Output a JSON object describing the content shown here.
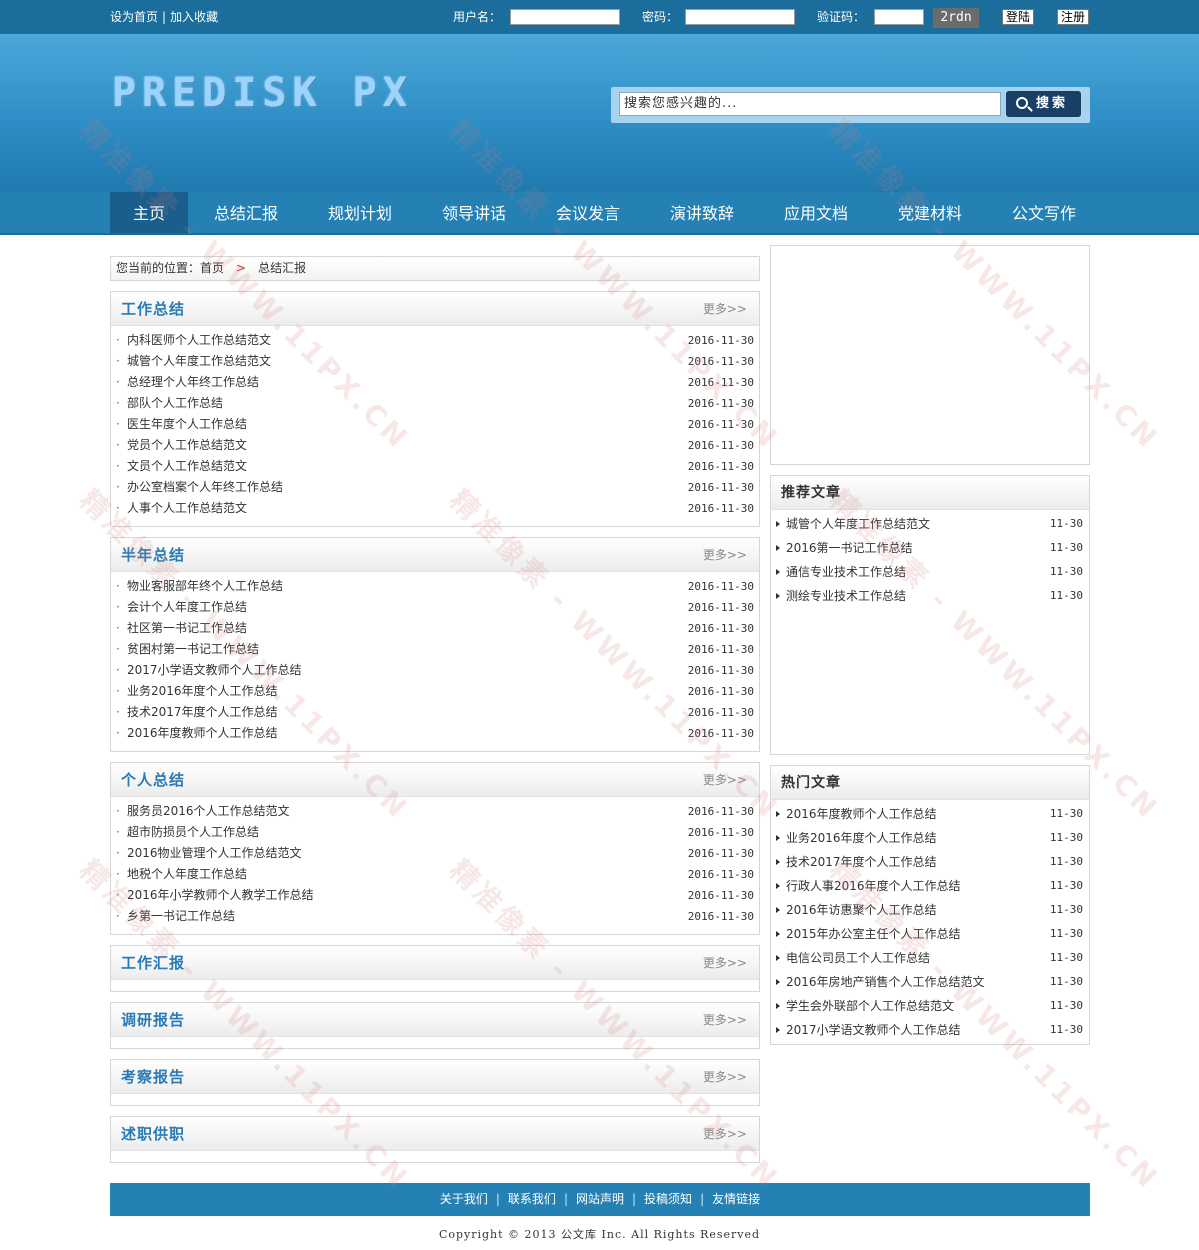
{
  "topbar": {
    "set_home": "设为首页",
    "add_fav": "加入收藏",
    "username_label": "用户名：",
    "password_label": "密码：",
    "captcha_label": "验证码：",
    "captcha_text": "2rdn",
    "login_button": "登陆",
    "register_button": "注册"
  },
  "header": {
    "logo_text": "PREDISK PX",
    "search_placeholder": "搜索您感兴趣的...",
    "search_button": "搜索"
  },
  "nav": {
    "items": [
      "主页",
      "总结汇报",
      "规划计划",
      "领导讲话",
      "会议发言",
      "演讲致辞",
      "应用文档",
      "党建材料",
      "公文写作"
    ]
  },
  "breadcrumb": {
    "prefix": "您当前的位置：",
    "home": "首页",
    "separator": ">",
    "current": "总结汇报"
  },
  "more_label": "更多>>",
  "sections": [
    {
      "title": "工作总结",
      "items": [
        {
          "title": "内科医师个人工作总结范文",
          "date": "2016-11-30"
        },
        {
          "title": "城管个人年度工作总结范文",
          "date": "2016-11-30"
        },
        {
          "title": "总经理个人年终工作总结",
          "date": "2016-11-30"
        },
        {
          "title": "部队个人工作总结",
          "date": "2016-11-30"
        },
        {
          "title": "医生年度个人工作总结",
          "date": "2016-11-30"
        },
        {
          "title": "党员个人工作总结范文",
          "date": "2016-11-30"
        },
        {
          "title": "文员个人工作总结范文",
          "date": "2016-11-30"
        },
        {
          "title": "办公室档案个人年终工作总结",
          "date": "2016-11-30"
        },
        {
          "title": "人事个人工作总结范文",
          "date": "2016-11-30"
        }
      ]
    },
    {
      "title": "半年总结",
      "items": [
        {
          "title": "物业客服部年终个人工作总结",
          "date": "2016-11-30"
        },
        {
          "title": "会计个人年度工作总结",
          "date": "2016-11-30"
        },
        {
          "title": "社区第一书记工作总结",
          "date": "2016-11-30"
        },
        {
          "title": "贫困村第一书记工作总结",
          "date": "2016-11-30"
        },
        {
          "title": "2017小学语文教师个人工作总结",
          "date": "2016-11-30"
        },
        {
          "title": "业务2016年度个人工作总结",
          "date": "2016-11-30"
        },
        {
          "title": "技术2017年度个人工作总结",
          "date": "2016-11-30"
        },
        {
          "title": "2016年度教师个人工作总结",
          "date": "2016-11-30"
        }
      ]
    },
    {
      "title": "个人总结",
      "items": [
        {
          "title": "服务员2016个人工作总结范文",
          "date": "2016-11-30"
        },
        {
          "title": "超市防损员个人工作总结",
          "date": "2016-11-30"
        },
        {
          "title": "2016物业管理个人工作总结范文",
          "date": "2016-11-30"
        },
        {
          "title": "地税个人年度工作总结",
          "date": "2016-11-30"
        },
        {
          "title": "2016年小学教师个人教学工作总结",
          "date": "2016-11-30"
        },
        {
          "title": "乡第一书记工作总结",
          "date": "2016-11-30"
        }
      ]
    },
    {
      "title": "工作汇报",
      "items": []
    },
    {
      "title": "调研报告",
      "items": []
    },
    {
      "title": "考察报告",
      "items": []
    },
    {
      "title": "述职供职",
      "items": []
    }
  ],
  "recommended": {
    "title": "推荐文章",
    "items": [
      {
        "title": "城管个人年度工作总结范文",
        "date": "11-30"
      },
      {
        "title": "2016第一书记工作总结",
        "date": "11-30"
      },
      {
        "title": "通信专业技术工作总结",
        "date": "11-30"
      },
      {
        "title": "测绘专业技术工作总结",
        "date": "11-30"
      }
    ]
  },
  "hot": {
    "title": "热门文章",
    "items": [
      {
        "title": "2016年度教师个人工作总结",
        "date": "11-30"
      },
      {
        "title": "业务2016年度个人工作总结",
        "date": "11-30"
      },
      {
        "title": "技术2017年度个人工作总结",
        "date": "11-30"
      },
      {
        "title": "行政人事2016年度个人工作总结",
        "date": "11-30"
      },
      {
        "title": "2016年访惠聚个人工作总结",
        "date": "11-30"
      },
      {
        "title": "2015年办公室主任个人工作总结",
        "date": "11-30"
      },
      {
        "title": "电信公司员工个人工作总结",
        "date": "11-30"
      },
      {
        "title": "2016年房地产销售个人工作总结范文",
        "date": "11-30"
      },
      {
        "title": "学生会外联部个人工作总结范文",
        "date": "11-30"
      },
      {
        "title": "2017小学语文教师个人工作总结",
        "date": "11-30"
      }
    ]
  },
  "footer": {
    "links": [
      "关于我们",
      "联系我们",
      "网站声明",
      "投稿须知",
      "友情链接"
    ],
    "copyright": "Copyright © 2013 公文库 Inc. All Rights Reserved"
  },
  "watermark": {
    "cn": "精准像素",
    "url": "WWW.11PX.CN"
  },
  "colors": {
    "topbar": "#1b6e9b",
    "nav": "#2580b4",
    "nav_active": "#1a5f8c",
    "section_title": "#2a7ab6"
  }
}
